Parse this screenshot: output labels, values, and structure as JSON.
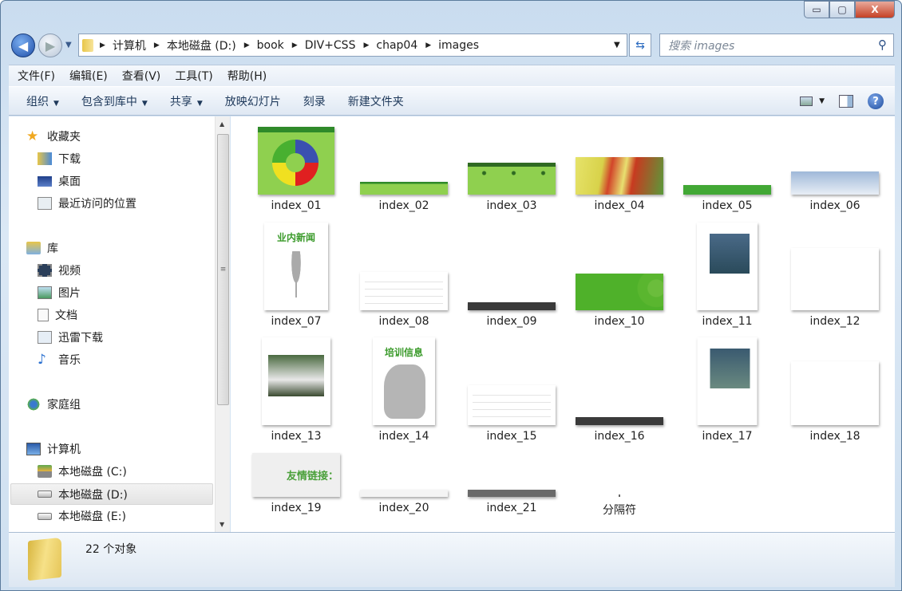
{
  "window": {
    "controls": {
      "minimize": "▭",
      "maximize": "▢",
      "close": "X"
    }
  },
  "address": {
    "breadcrumbs": [
      "计算机",
      "本地磁盘 (D:)",
      "book",
      "DIV+CSS",
      "chap04",
      "images"
    ],
    "search_placeholder": "搜索 images"
  },
  "menu": [
    "文件(F)",
    "编辑(E)",
    "查看(V)",
    "工具(T)",
    "帮助(H)"
  ],
  "toolbar": {
    "organize": "组织",
    "include": "包含到库中",
    "share": "共享",
    "slideshow": "放映幻灯片",
    "burn": "刻录",
    "new_folder": "新建文件夹"
  },
  "nav": {
    "favorites": "收藏夹",
    "downloads": "下载",
    "desktop": "桌面",
    "recent": "最近访问的位置",
    "libraries": "库",
    "videos": "视频",
    "pictures": "图片",
    "documents": "文档",
    "thunder": "迅雷下载",
    "music": "音乐",
    "homegroup": "家庭组",
    "computer": "计算机",
    "drive_c": "本地磁盘 (C:)",
    "drive_d": "本地磁盘 (D:)",
    "drive_e": "本地磁盘 (E:)"
  },
  "files": [
    {
      "name": "index_01"
    },
    {
      "name": "index_02"
    },
    {
      "name": "index_03"
    },
    {
      "name": "index_04"
    },
    {
      "name": "index_05"
    },
    {
      "name": "index_06"
    },
    {
      "name": "index_07",
      "thumb_text": "业内新闻"
    },
    {
      "name": "index_08"
    },
    {
      "name": "index_09"
    },
    {
      "name": "index_10"
    },
    {
      "name": "index_11"
    },
    {
      "name": "index_12"
    },
    {
      "name": "index_13"
    },
    {
      "name": "index_14",
      "thumb_text": "培训信息"
    },
    {
      "name": "index_15"
    },
    {
      "name": "index_16"
    },
    {
      "name": "index_17"
    },
    {
      "name": "index_18"
    },
    {
      "name": "index_19",
      "thumb_text": "友情链接："
    },
    {
      "name": "index_20"
    },
    {
      "name": "index_21"
    },
    {
      "name": "分隔符"
    }
  ],
  "status": {
    "count": "22 个对象"
  },
  "colors": {
    "green": "#7bc142",
    "dark_green": "#3a9a2a",
    "selection": "#e5e5e5"
  }
}
